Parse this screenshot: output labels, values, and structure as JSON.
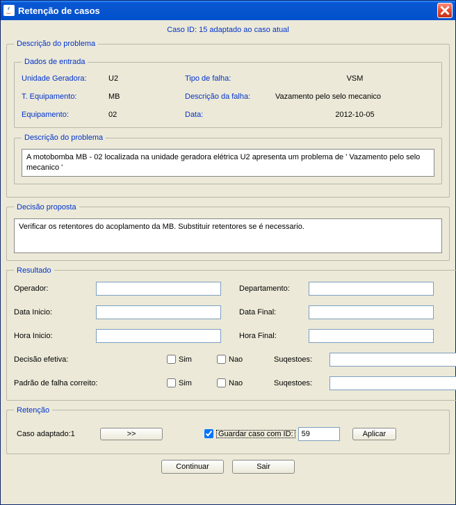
{
  "window": {
    "title": "Retenção de casos"
  },
  "caseHeader": "Caso ID: 15 adaptado ao caso atual",
  "problemDesc": {
    "legend": "Descrição do problema",
    "inputData": {
      "legend": "Dados de entrada",
      "unitGen": {
        "label": "Unidade Geradora:",
        "value": "U2"
      },
      "failType": {
        "label": "Tipo de falha:",
        "value": "VSM"
      },
      "equipType": {
        "label": "T. Equipamento:",
        "value": "MB"
      },
      "failDesc": {
        "label": "Descrição da falha:",
        "value": "Vazamento pelo selo mecanico"
      },
      "equipment": {
        "label": "Equipamento:",
        "value": "02"
      },
      "date": {
        "label": "Data:",
        "value": "2012-10-05"
      }
    },
    "descBox": {
      "legend": "Descrição do problema",
      "text": "A motobomba MB - 02 localizada na unidade geradora elétrica U2 apresenta um problema de   ' Vazamento pelo selo mecanico '"
    }
  },
  "decision": {
    "legend": "Decisão proposta",
    "text": "Verificar os retentores do acoplamento da MB. Substituir retentores se é necessario."
  },
  "result": {
    "legend": "Resultado",
    "operator": {
      "label": "Operador:",
      "value": ""
    },
    "department": {
      "label": "Departamento:",
      "value": ""
    },
    "startDate": {
      "label": "Data Inicio:",
      "value": ""
    },
    "endDate": {
      "label": "Data Final:",
      "value": ""
    },
    "startTime": {
      "label": "Hora Inicio:",
      "value": ""
    },
    "endTime": {
      "label": "Hora Final:",
      "value": ""
    },
    "effective": {
      "label": "Decisão efetiva:",
      "yes": "Sim",
      "no": "Nao",
      "sugLabel": "Suqestoes:",
      "sugValue": ""
    },
    "pattern": {
      "label": "Padrão de falha correito:",
      "yes": "Sim",
      "no": "Nao",
      "sugLabel": "Suqestoes:",
      "sugValue": ""
    }
  },
  "retention": {
    "legend": "Retenção",
    "adaptedLabel": "Caso adaptado:1",
    "arrowBtn": ">>",
    "saveCheck": true,
    "saveLabel": "Guardar caso com ID:",
    "idValue": "59",
    "apply": "Aplicar"
  },
  "bottom": {
    "continue": "Continuar",
    "exit": "Sair"
  }
}
